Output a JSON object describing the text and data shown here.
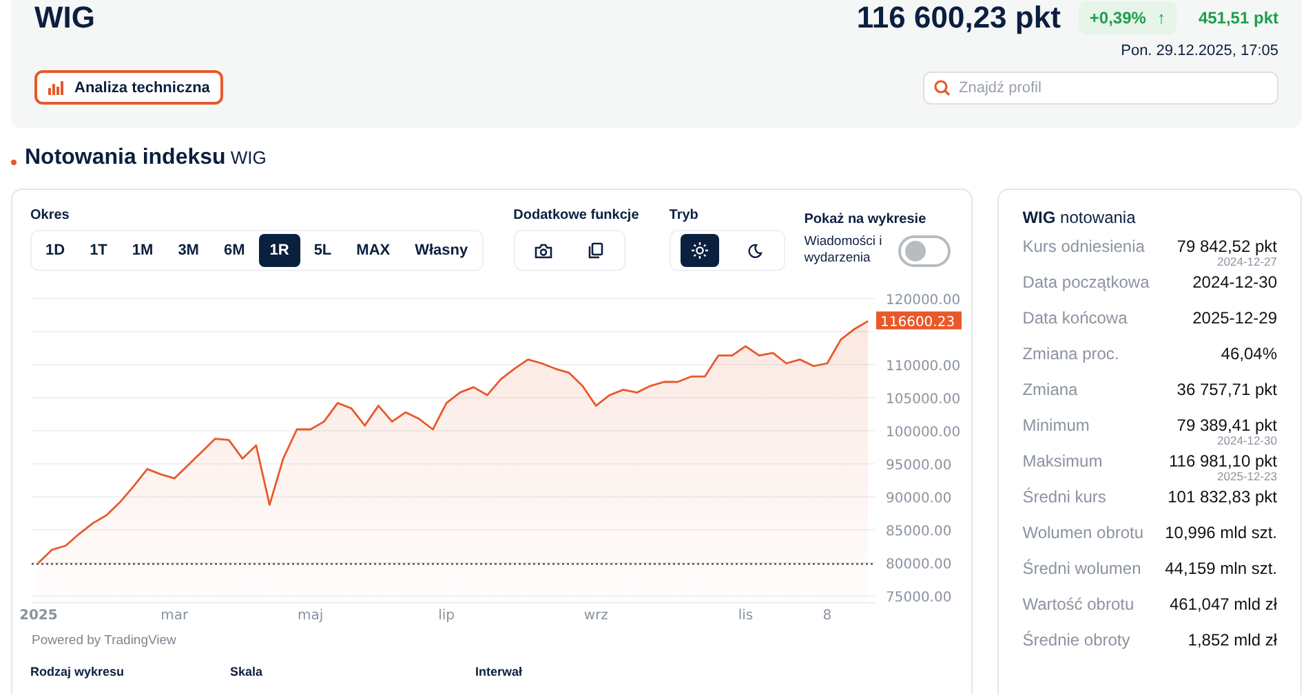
{
  "header": {
    "title": "WIG",
    "price": "116 600,23 pkt",
    "change_pct": "+0,39%",
    "change_arrow": "↑",
    "change_abs": "451,51 pkt",
    "datetime": "Pon. 29.12.2025, 17:05",
    "analysis_button": "Analiza techniczna",
    "search": {
      "placeholder": "Znajdź profil"
    }
  },
  "section_title": "**Notowania indeksu** WIG",
  "chart_panel": {
    "period_label": "Okres",
    "periods": [
      {
        "label": "1D",
        "selected": false
      },
      {
        "label": "1T",
        "selected": false
      },
      {
        "label": "1M",
        "selected": false
      },
      {
        "label": "3M",
        "selected": false
      },
      {
        "label": "6M",
        "selected": false
      },
      {
        "label": "1R",
        "selected": true
      },
      {
        "label": "5L",
        "selected": false
      },
      {
        "label": "MAX",
        "selected": false
      },
      {
        "label": "Własny",
        "selected": false
      }
    ],
    "functions_label": "Dodatkowe funkcje",
    "mode_label": "Tryb",
    "modes": [
      {
        "kind": "light",
        "selected": true
      },
      {
        "kind": "dark",
        "selected": false
      }
    ],
    "show_label": "Pokaż na wykresie",
    "news_toggle": {
      "label": "Wiadomości i wydarzenia",
      "on": false
    },
    "chart_data": {
      "type": "area",
      "grid": true,
      "categories": [
        "2025",
        null,
        null,
        null,
        null,
        null,
        null,
        null,
        null,
        null,
        "mar",
        null,
        null,
        null,
        null,
        null,
        null,
        null,
        null,
        null,
        "maj",
        null,
        null,
        null,
        null,
        null,
        null,
        null,
        null,
        null,
        "lip",
        null,
        null,
        null,
        null,
        null,
        null,
        null,
        null,
        null,
        null,
        "wrz",
        null,
        null,
        null,
        null,
        null,
        null,
        null,
        null,
        null,
        null,
        "lis",
        null,
        null,
        null,
        null,
        null,
        "8",
        null,
        null,
        null
      ],
      "ylim": [
        75000,
        120000
      ],
      "yticks": [
        {
          "value": 120000,
          "label": "120000.00"
        },
        {
          "value": 110000,
          "label": "110000.00"
        },
        {
          "value": 105000,
          "label": "105000.00"
        },
        {
          "value": 100000,
          "label": "100000.00"
        },
        {
          "value": 95000,
          "label": "95000.00"
        },
        {
          "value": 90000,
          "label": "90000.00"
        },
        {
          "value": 85000,
          "label": "85000.00"
        },
        {
          "value": 80000,
          "label": "80000.00"
        },
        {
          "value": 75000,
          "label": "75000.00"
        }
      ],
      "series": [
        {
          "color": "#e8582a",
          "values": [
            80000,
            82000,
            82600,
            84400,
            86000,
            87200,
            89200,
            91600,
            94200,
            93400,
            92800,
            94800,
            96800,
            98800,
            98600,
            95800,
            97800,
            88800,
            95800,
            100200,
            100200,
            101400,
            104200,
            103400,
            100800,
            103800,
            101400,
            102800,
            101800,
            100200,
            104200,
            105800,
            106600,
            105400,
            107800,
            109400,
            110800,
            110200,
            109400,
            108800,
            106800,
            103800,
            105400,
            106200,
            105800,
            106800,
            107400,
            107400,
            108200,
            108200,
            111400,
            111400,
            112800,
            111400,
            111800,
            110200,
            110800,
            109800,
            110200,
            113800,
            115400,
            116600
          ]
        }
      ],
      "annotations": [
        "116600.23"
      ],
      "ref_lines": [
        {
          "axis": "y",
          "value": 79842.52
        }
      ]
    },
    "powered_by": "Powered by TradingView",
    "bottom_labels": [
      "Rodzaj wykresu",
      "Skala",
      "Interwał"
    ]
  },
  "stats": {
    "title": "**WIG** notowania",
    "rows": [
      {
        "label": "Kurs odniesienia",
        "value": "79 842,52 pkt",
        "date": "2024-12-27"
      },
      {
        "label": "Data początkowa",
        "value": "2024-12-30"
      },
      {
        "label": "Data końcowa",
        "value": "2025-12-29"
      },
      {
        "label": "Zmiana proc.",
        "value": "46,04%"
      },
      {
        "label": "Zmiana",
        "value": "36 757,71 pkt"
      },
      {
        "label": "Minimum",
        "value": "79 389,41 pkt",
        "date": "2024-12-30"
      },
      {
        "label": "Maksimum",
        "value": "116 981,10 pkt",
        "date": "2025-12-23"
      },
      {
        "label": "Średni kurs",
        "value": "101 832,83 pkt"
      },
      {
        "label": "Wolumen obrotu",
        "value": "10,996 mld szt."
      },
      {
        "label": "Średni wolumen",
        "value": "44,159 mln szt."
      },
      {
        "label": "Wartość obrotu",
        "value": "461,047 mld zł"
      },
      {
        "label": "Średnie obroty",
        "value": "1,852 mld zł"
      }
    ]
  }
}
